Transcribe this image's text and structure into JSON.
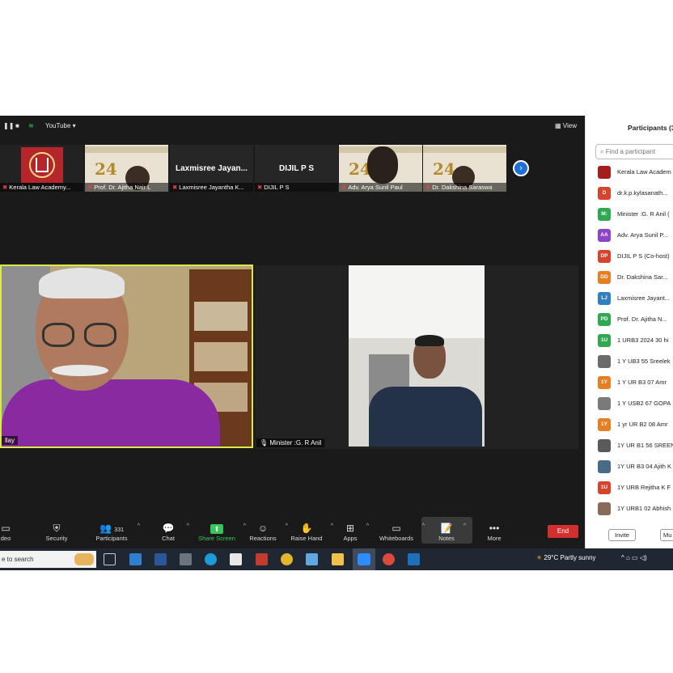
{
  "topbar": {
    "pause": "❚❚",
    "stop": "■",
    "signal": "≋",
    "app": "YouTube ▾",
    "view": "▦ View"
  },
  "thumbnails": [
    {
      "name": "Kerala Law Academy..."
    },
    {
      "name": "Prof. Dr. Ajitha Nair L"
    },
    {
      "name": "Laxmisree Jayantha K...",
      "display": "Laxmisree Jayan..."
    },
    {
      "name": "DIJIL P S",
      "display": "DIJIL P S"
    },
    {
      "name": "Adv. Arya Sunil Paul"
    },
    {
      "name": "Dr. Dakshina Saraswa"
    }
  ],
  "poster_number": "24",
  "next_arrow": "›",
  "videos": {
    "left_name": "llay",
    "right_name": "Minister :G. R Anil"
  },
  "toolbar": {
    "items": [
      {
        "icon": "▭",
        "label": "deo"
      },
      {
        "icon": "⛨",
        "label": "Security"
      },
      {
        "icon": "👥",
        "label": "Participants",
        "count": "331"
      },
      {
        "icon": "💬",
        "label": "Chat"
      },
      {
        "icon": "⬆",
        "label": "Share Screen"
      },
      {
        "icon": "☺",
        "label": "Reactions"
      },
      {
        "icon": "✋",
        "label": "Raise Hand"
      },
      {
        "icon": "⊞",
        "label": "Apps"
      },
      {
        "icon": "▭",
        "label": "Whiteboards"
      },
      {
        "icon": "📝",
        "label": "Notes"
      },
      {
        "icon": "•••",
        "label": "More"
      }
    ],
    "caret": "^",
    "end": "End"
  },
  "panel": {
    "title": "Participants (3",
    "search_placeholder": "Find a participant",
    "participants": [
      {
        "initials": "",
        "name": "Kerala Law Academ",
        "color": "#a51d1d"
      },
      {
        "initials": "D",
        "name": "dr.k.p.kylasanath...",
        "color": "#d6452b"
      },
      {
        "initials": "M:",
        "name": "Minister :G. R Anil (",
        "color": "#2fa84f"
      },
      {
        "initials": "AA",
        "name": "Adv. Arya Sunil P...",
        "color": "#8e44c9"
      },
      {
        "initials": "DP",
        "name": "DIJIL P S (Co-host)",
        "color": "#d6452b"
      },
      {
        "initials": "DD",
        "name": "Dr. Dakshina Sar...",
        "color": "#e67e22"
      },
      {
        "initials": "LJ",
        "name": "Laxmisree Jayant...",
        "color": "#2f7fc1"
      },
      {
        "initials": "PD",
        "name": "Prof. Dr. Ajitha N...",
        "color": "#2fa84f"
      },
      {
        "initials": "1U",
        "name": "1 URB3 2024 30 hi",
        "color": "#2fa84f"
      },
      {
        "initials": "",
        "name": "1 Y UB3 55 Sreelek",
        "color": "#6b6b6b"
      },
      {
        "initials": "1Y",
        "name": "1 Y UR B3  07 Amr",
        "color": "#e67e22"
      },
      {
        "initials": "",
        "name": "1 Y USB2 67 GOPA",
        "color": "#7a7a7a"
      },
      {
        "initials": "1Y",
        "name": "1 yr UR B2 08 Amr",
        "color": "#e67e22"
      },
      {
        "initials": "",
        "name": "1Y UR B1 56 SREEN",
        "color": "#5a5a5a"
      },
      {
        "initials": "",
        "name": "1Y UR B3 04 Ajith K",
        "color": "#4a6a8a"
      },
      {
        "initials": "1U",
        "name": "1Y URB  Rejitha K F",
        "color": "#d6452b"
      },
      {
        "initials": "",
        "name": "1Y URB1 02 Abhish",
        "color": "#8a6a5a"
      }
    ],
    "invite": "Invite",
    "mute": "Mu"
  },
  "taskbar": {
    "search": "e to search",
    "weather": "29°C  Partly sunny",
    "tray": "^  ⌂  ▭  ◁)"
  }
}
